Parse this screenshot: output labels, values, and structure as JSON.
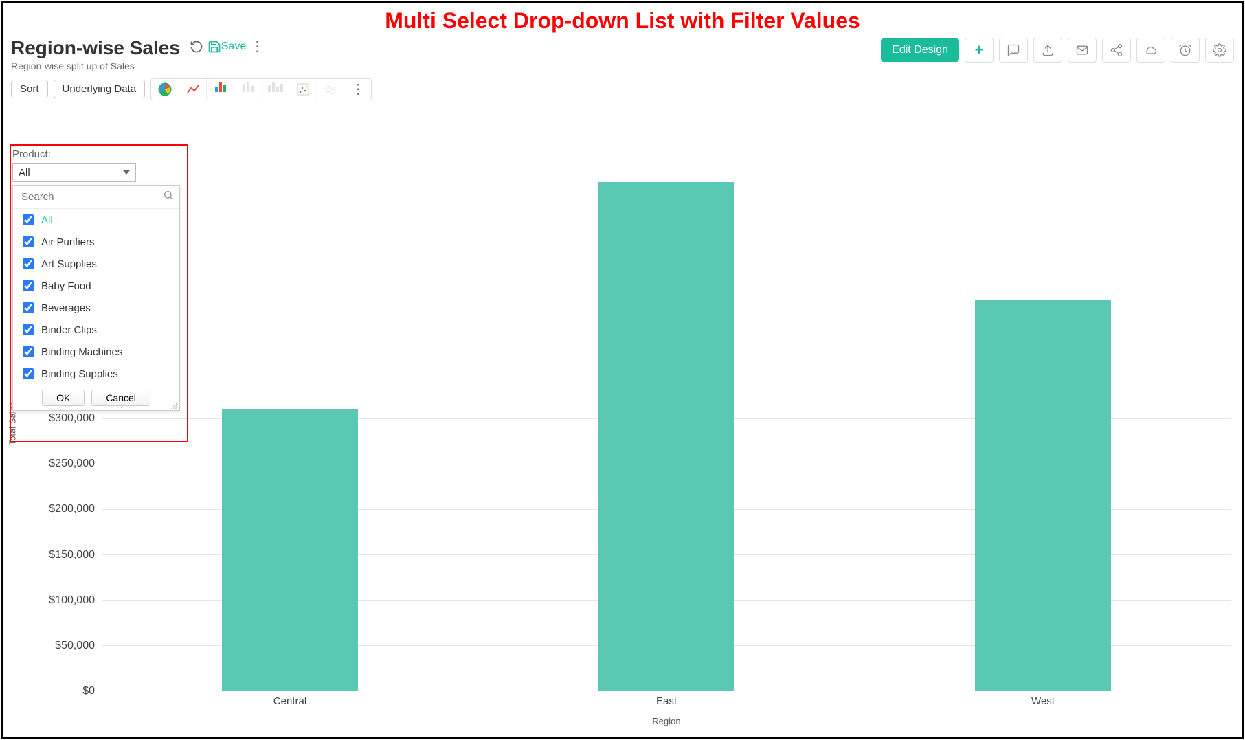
{
  "annotation_title": "Multi Select Drop-down List with Filter Values",
  "header": {
    "title": "Region-wise Sales",
    "subtitle": "Region-wise split up of Sales",
    "save_label": "Save",
    "edit_label": "Edit Design"
  },
  "toolbar2": {
    "sort_label": "Sort",
    "underlying_label": "Underlying Data"
  },
  "filter": {
    "label": "Product:",
    "selected": "All",
    "search_placeholder": "Search",
    "ok_label": "OK",
    "cancel_label": "Cancel",
    "options": [
      {
        "label": "All",
        "checked": true,
        "all": true
      },
      {
        "label": "Air Purifiers",
        "checked": true
      },
      {
        "label": "Art Supplies",
        "checked": true
      },
      {
        "label": "Baby Food",
        "checked": true
      },
      {
        "label": "Beverages",
        "checked": true
      },
      {
        "label": "Binder Clips",
        "checked": true
      },
      {
        "label": "Binding Machines",
        "checked": true
      },
      {
        "label": "Binding Supplies",
        "checked": true
      }
    ]
  },
  "chart_data": {
    "type": "bar",
    "title": "",
    "xlabel": "Region",
    "ylabel": "Total Sales",
    "categories": [
      "Central",
      "East",
      "West"
    ],
    "values": [
      310000,
      560000,
      430000
    ],
    "ylim": [
      0,
      600000
    ],
    "y_ticks": [
      "$0",
      "$50,000",
      "$100,000",
      "$150,000",
      "$200,000",
      "$250,000",
      "$300,000"
    ],
    "bar_color": "#5ac8b2"
  }
}
